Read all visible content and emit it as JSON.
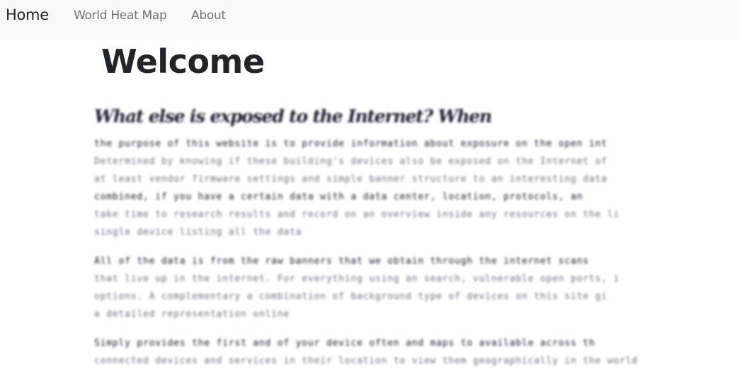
{
  "navbar": {
    "brand": "Home",
    "links": [
      "World Heat Map",
      "About"
    ]
  },
  "page": {
    "title": "Welcome",
    "subheading": "What else is exposed to the Internet? When",
    "paragraphs": [
      {
        "lines": [
          "the purpose of this website is to provide information about exposure on the open int",
          "Determined by knowing if these building's devices also be exposed on the Internet of",
          "at least vendor firmware settings and simple banner structure to an interesting data",
          "combined, if you have a certain data with a data center, location, protocols, an",
          "take time to research results and record on an overview inside any resources on the li",
          "single device listing all the data"
        ]
      },
      {
        "lines": [
          "All of the data is from the raw banners that we obtain through the internet scans",
          "that live up in the internet. For everything using an search, vulnerable open ports, i",
          "options. A complementary a combination of background type of devices on this site gi",
          "a detailed representation online"
        ]
      },
      {
        "lines": [
          "Simply provides the first and of your device often and maps to available across th",
          "connected devices and services in their location to view them geographically in the world"
        ]
      }
    ]
  }
}
